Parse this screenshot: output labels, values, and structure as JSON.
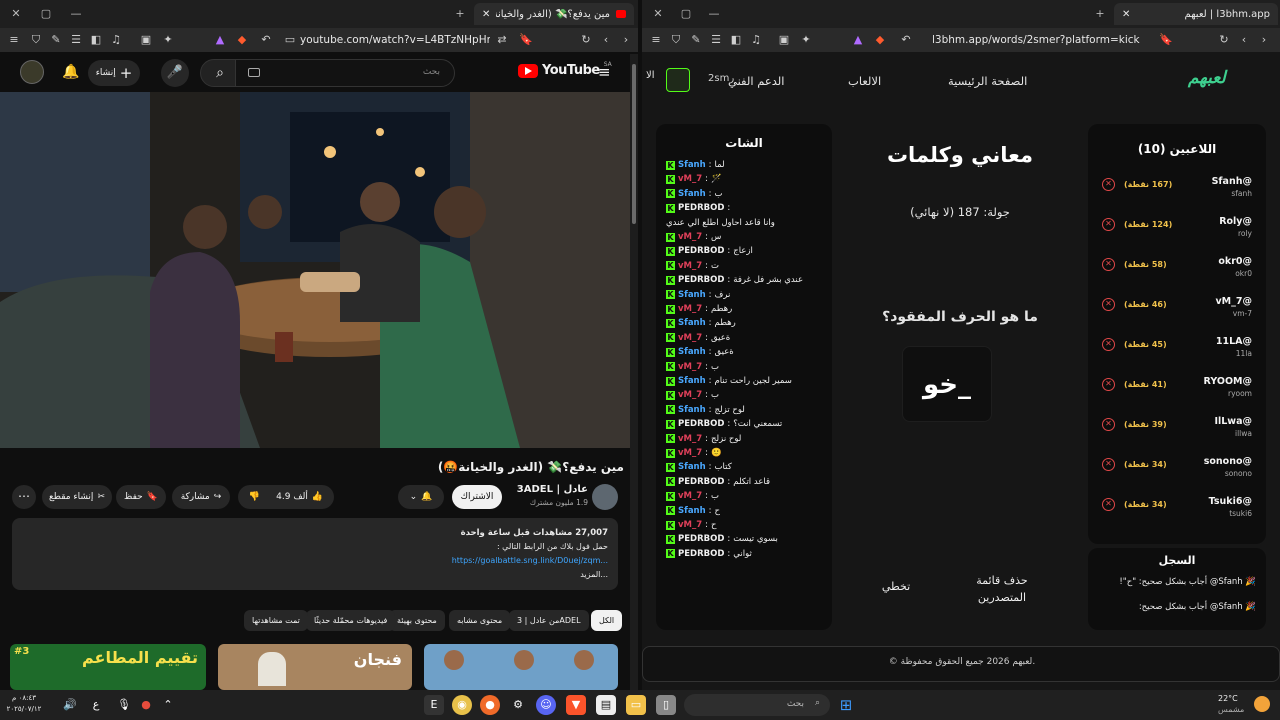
{
  "left_window": {
    "tab_title": "مين يدفع؟💸 (الغدر والخيانة🤬) - ...",
    "url": "youtube.com/watch?v=L4BTzNHpHmc",
    "youtube": {
      "logo_text": "YouTube",
      "region": "SA",
      "search_placeholder": "بحث",
      "create_label": "إنشاء",
      "video_title": "مين يدفع؟💸 (الغدر والخيانة🤬)",
      "channel_name": "عادل | 3ADEL",
      "subscribers": "1.9 مليون مشترك",
      "subscribe_label": "الاشتراك",
      "likes": "4.9 ألف",
      "share_label": "مشاركة",
      "save_label": "حفظ",
      "clip_label": "إنشاء مقطع",
      "views": "27,007 مشاهدات  قبل ساعة واحدة",
      "desc_line": "حمل فول بلاك من الرابط التالي :",
      "desc_link": "https://goalbattle.sng.link/D0uej/zqm...",
      "more_label": "...المزيد",
      "chips": [
        "الكل",
        "من عادل | 3ADEL",
        "محتوى مشابه",
        "محتوى بهيئة",
        "فيديوهات محمّلة حديثًا",
        "تمت مشاهدتها"
      ],
      "thumb_texts": [
        "تقييم المطاعم",
        "فنجان",
        ""
      ],
      "thumb_badge": "#3"
    }
  },
  "right_window": {
    "tab_title": "لعبهم | l3bhm.app",
    "url": "l3bhm.app/words/2smer?platform=kick",
    "site": {
      "logo": "لعبهم",
      "nav_home": "الصفحة الرئيسية",
      "nav_games": "الالعاب",
      "nav_support": "الدعم الفني",
      "user_tag": "2smر",
      "nav_cut": "الا"
    },
    "players_title": "اللاعبين (10)",
    "players": [
      {
        "name": "@Sfanh",
        "handle": "sfanh",
        "points": "(167 نقطة)"
      },
      {
        "name": "@Roly",
        "handle": "roly",
        "points": "(124 نقطة)"
      },
      {
        "name": "@okr0",
        "handle": "okr0",
        "points": "(58 نقطة)"
      },
      {
        "name": "@vM_7",
        "handle": "vm-7",
        "points": "(46 نقطة)"
      },
      {
        "name": "@11LA",
        "handle": "11la",
        "points": "(45 نقطة)"
      },
      {
        "name": "@RYOOM",
        "handle": "ryoom",
        "points": "(41 نقطة)"
      },
      {
        "name": "@IlLwa",
        "handle": "illwa",
        "points": "(39 نقطة)"
      },
      {
        "name": "@sonono",
        "handle": "sonono",
        "points": "(34 نقطة)"
      },
      {
        "name": "@Tsuki6",
        "handle": "tsuki6",
        "points": "(34 نقطة)"
      }
    ],
    "log_title": "السجل",
    "log_entries": [
      "🎉 Sfanh@ أجاب بشكل صحيح: \"ح\"!",
      "🎉 Sfanh@ أجاب بشكل صحيح:"
    ],
    "game_title": "معاني وكلمات",
    "round_text": "جولة: 187 (لا نهائي)",
    "question": "ما هو الحرف المفقود؟",
    "word_display": "خو_",
    "btn_clear_leaderboard": "حذف قائمة المتصدرين",
    "btn_skip": "تخطي",
    "chat_title": "الشات",
    "chat": [
      {
        "user": "Sfanh",
        "color": "#4aa8ff",
        "msg": "لما"
      },
      {
        "user": "vM_7",
        "color": "#e0405a",
        "msg": "🪄"
      },
      {
        "user": "Sfanh",
        "color": "#4aa8ff",
        "msg": "ب"
      },
      {
        "user": "PEDRBOD",
        "color": "#f1f1f1",
        "msg": ""
      },
      {
        "user": "",
        "color": "#f1f1f1",
        "msg": "وانا قاعد احاول اطلع الي عندي"
      },
      {
        "user": "vM_7",
        "color": "#e0405a",
        "msg": "س"
      },
      {
        "user": "PEDRBOD",
        "color": "#f1f1f1",
        "msg": "ازعاج"
      },
      {
        "user": "vM_7",
        "color": "#e0405a",
        "msg": "ت"
      },
      {
        "user": "PEDRBOD",
        "color": "#f1f1f1",
        "msg": "عندي بشر فل غرفة"
      },
      {
        "user": "Sfanh",
        "color": "#4aa8ff",
        "msg": "نرف"
      },
      {
        "user": "vM_7",
        "color": "#e0405a",
        "msg": "رهطم"
      },
      {
        "user": "Sfanh",
        "color": "#4aa8ff",
        "msg": "رهطم"
      },
      {
        "user": "vM_7",
        "color": "#e0405a",
        "msg": "ةعيق"
      },
      {
        "user": "Sfanh",
        "color": "#4aa8ff",
        "msg": "ةعيق"
      },
      {
        "user": "vM_7",
        "color": "#e0405a",
        "msg": "ب"
      },
      {
        "user": "Sfanh",
        "color": "#4aa8ff",
        "msg": "سمير لجين راحت تنام"
      },
      {
        "user": "vM_7",
        "color": "#e0405a",
        "msg": "ب"
      },
      {
        "user": "Sfanh",
        "color": "#4aa8ff",
        "msg": "لوح تزلج"
      },
      {
        "user": "PEDRBOD",
        "color": "#f1f1f1",
        "msg": "تسمعني انت؟"
      },
      {
        "user": "vM_7",
        "color": "#e0405a",
        "msg": "لوح نزلج"
      },
      {
        "user": "vM_7",
        "color": "#e0405a",
        "msg": "🙂"
      },
      {
        "user": "Sfanh",
        "color": "#4aa8ff",
        "msg": "كتاب"
      },
      {
        "user": "PEDRBOD",
        "color": "#f1f1f1",
        "msg": "قاعد اتكلم"
      },
      {
        "user": "vM_7",
        "color": "#e0405a",
        "msg": "ب"
      },
      {
        "user": "Sfanh",
        "color": "#4aa8ff",
        "msg": "ح"
      },
      {
        "user": "vM_7",
        "color": "#e0405a",
        "msg": "ح"
      },
      {
        "user": "PEDRBOD",
        "color": "#f1f1f1",
        "msg": "بسوي تيست"
      },
      {
        "user": "PEDRBOD",
        "color": "#f1f1f1",
        "msg": "ثواني"
      }
    ],
    "footer_text": "© لعبهم 2026 جميع الحقوق محفوظة."
  },
  "taskbar": {
    "search_placeholder": "بحث",
    "temp": "22°C",
    "weather": "مشمس",
    "time": "٠٨:٤٣ م",
    "date": "٢٠٢٥/٠٧/١٢",
    "lang": "ع"
  },
  "colors": {
    "accent_red": "#ff0000",
    "kick_green": "#53fc18",
    "points_gold": "#f0c14b"
  }
}
